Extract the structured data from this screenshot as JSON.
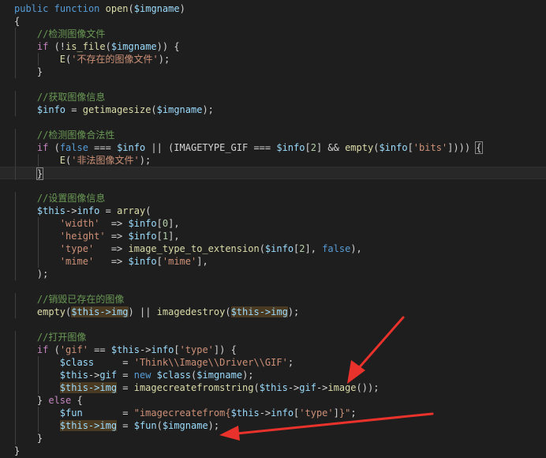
{
  "editor": {
    "lines": [
      [
        [
          "kw",
          "public"
        ],
        [
          "p",
          " "
        ],
        [
          "kw",
          "function"
        ],
        [
          "p",
          " "
        ],
        [
          "fn",
          "open"
        ],
        [
          "p",
          "("
        ],
        [
          "var",
          "$imgname"
        ],
        [
          "p",
          ")"
        ]
      ],
      [
        [
          "p",
          "{"
        ]
      ],
      [
        [
          "p",
          "    "
        ],
        [
          "cm",
          "//检测图像文件"
        ]
      ],
      [
        [
          "p",
          "    "
        ],
        [
          "ctl",
          "if"
        ],
        [
          "p",
          " (!"
        ],
        [
          "fn",
          "is_file"
        ],
        [
          "p",
          "("
        ],
        [
          "var",
          "$imgname"
        ],
        [
          "p",
          ")) {"
        ]
      ],
      [
        [
          "p",
          "        "
        ],
        [
          "fn",
          "E"
        ],
        [
          "p",
          "("
        ],
        [
          "str",
          "'不存在的图像文件'"
        ],
        [
          "p",
          ");"
        ]
      ],
      [
        [
          "p",
          "    }"
        ]
      ],
      [
        [
          "p",
          ""
        ]
      ],
      [
        [
          "p",
          "    "
        ],
        [
          "cm",
          "//获取图像信息"
        ]
      ],
      [
        [
          "p",
          "    "
        ],
        [
          "var",
          "$info"
        ],
        [
          "p",
          " = "
        ],
        [
          "fn",
          "getimagesize"
        ],
        [
          "p",
          "("
        ],
        [
          "var",
          "$imgname"
        ],
        [
          "p",
          ");"
        ]
      ],
      [
        [
          "p",
          ""
        ]
      ],
      [
        [
          "p",
          "    "
        ],
        [
          "cm",
          "//检测图像合法性"
        ]
      ],
      [
        [
          "p",
          "    "
        ],
        [
          "ctl",
          "if"
        ],
        [
          "p",
          " ("
        ],
        [
          "kw",
          "false"
        ],
        [
          "p",
          " === "
        ],
        [
          "var",
          "$info"
        ],
        [
          "p",
          " || (IMAGETYPE_GIF === "
        ],
        [
          "var",
          "$info"
        ],
        [
          "p",
          "["
        ],
        [
          "num",
          "2"
        ],
        [
          "p",
          "] && "
        ],
        [
          "fn",
          "empty"
        ],
        [
          "p",
          "("
        ],
        [
          "var",
          "$info"
        ],
        [
          "p",
          "["
        ],
        [
          "str",
          "'bits'"
        ],
        [
          "p",
          "]))) "
        ],
        [
          "bm",
          "{"
        ]
      ],
      [
        [
          "p",
          "        "
        ],
        [
          "fn",
          "E"
        ],
        [
          "p",
          "("
        ],
        [
          "str",
          "'非法图像文件'"
        ],
        [
          "p",
          ");"
        ]
      ],
      [
        [
          "p",
          "    "
        ],
        [
          "bm",
          "}"
        ]
      ],
      [
        [
          "p",
          ""
        ]
      ],
      [
        [
          "p",
          "    "
        ],
        [
          "cm",
          "//设置图像信息"
        ]
      ],
      [
        [
          "p",
          "    "
        ],
        [
          "var",
          "$this"
        ],
        [
          "p",
          "->"
        ],
        [
          "var",
          "info"
        ],
        [
          "p",
          " = "
        ],
        [
          "fn",
          "array"
        ],
        [
          "p",
          "("
        ]
      ],
      [
        [
          "p",
          "        "
        ],
        [
          "str",
          "'width'"
        ],
        [
          "p",
          "  => "
        ],
        [
          "var",
          "$info"
        ],
        [
          "p",
          "["
        ],
        [
          "num",
          "0"
        ],
        [
          "p",
          "],"
        ]
      ],
      [
        [
          "p",
          "        "
        ],
        [
          "str",
          "'height'"
        ],
        [
          "p",
          " => "
        ],
        [
          "var",
          "$info"
        ],
        [
          "p",
          "["
        ],
        [
          "num",
          "1"
        ],
        [
          "p",
          "],"
        ]
      ],
      [
        [
          "p",
          "        "
        ],
        [
          "str",
          "'type'"
        ],
        [
          "p",
          "   => "
        ],
        [
          "fn",
          "image_type_to_extension"
        ],
        [
          "p",
          "("
        ],
        [
          "var",
          "$info"
        ],
        [
          "p",
          "["
        ],
        [
          "num",
          "2"
        ],
        [
          "p",
          "], "
        ],
        [
          "kw",
          "false"
        ],
        [
          "p",
          "),"
        ]
      ],
      [
        [
          "p",
          "        "
        ],
        [
          "str",
          "'mime'"
        ],
        [
          "p",
          "   => "
        ],
        [
          "var",
          "$info"
        ],
        [
          "p",
          "["
        ],
        [
          "str",
          "'mime'"
        ],
        [
          "p",
          "],"
        ]
      ],
      [
        [
          "p",
          "    );"
        ]
      ],
      [
        [
          "p",
          ""
        ]
      ],
      [
        [
          "p",
          "    "
        ],
        [
          "cm",
          "//销毁已存在的图像"
        ]
      ],
      [
        [
          "p",
          "    "
        ],
        [
          "fn",
          "empty"
        ],
        [
          "p",
          "("
        ],
        [
          "var",
          "$this->img"
        ],
        [
          "p",
          ") || "
        ],
        [
          "fn",
          "imagedestroy"
        ],
        [
          "p",
          "("
        ],
        [
          "var",
          "$this->img"
        ],
        [
          "p",
          ");"
        ]
      ],
      [
        [
          "p",
          ""
        ]
      ],
      [
        [
          "p",
          "    "
        ],
        [
          "cm",
          "//打开图像"
        ]
      ],
      [
        [
          "p",
          "    "
        ],
        [
          "ctl",
          "if"
        ],
        [
          "p",
          " ("
        ],
        [
          "str",
          "'gif'"
        ],
        [
          "p",
          " == "
        ],
        [
          "var",
          "$this"
        ],
        [
          "p",
          "->"
        ],
        [
          "var",
          "info"
        ],
        [
          "p",
          "["
        ],
        [
          "str",
          "'type'"
        ],
        [
          "p",
          "]) {"
        ]
      ],
      [
        [
          "p",
          "        "
        ],
        [
          "var",
          "$class"
        ],
        [
          "p",
          "     = "
        ],
        [
          "str",
          "'Think\\\\Image\\\\Driver\\\\GIF'"
        ],
        [
          "p",
          ";"
        ]
      ],
      [
        [
          "p",
          "        "
        ],
        [
          "var",
          "$this"
        ],
        [
          "p",
          "->"
        ],
        [
          "var",
          "gif"
        ],
        [
          "p",
          " = "
        ],
        [
          "kw",
          "new"
        ],
        [
          "p",
          " "
        ],
        [
          "var",
          "$class"
        ],
        [
          "p",
          "("
        ],
        [
          "var",
          "$imgname"
        ],
        [
          "p",
          ");"
        ]
      ],
      [
        [
          "p",
          "        "
        ],
        [
          "var",
          "$this->img"
        ],
        [
          "p",
          " = "
        ],
        [
          "fn",
          "imagecreatefromstring"
        ],
        [
          "p",
          "("
        ],
        [
          "var",
          "$this"
        ],
        [
          "p",
          "->"
        ],
        [
          "var",
          "gif"
        ],
        [
          "p",
          "->"
        ],
        [
          "fn",
          "image"
        ],
        [
          "p",
          "());"
        ]
      ],
      [
        [
          "p",
          "    } "
        ],
        [
          "ctl",
          "else"
        ],
        [
          "p",
          " {"
        ]
      ],
      [
        [
          "p",
          "        "
        ],
        [
          "var",
          "$fun"
        ],
        [
          "p",
          "       = "
        ],
        [
          "str",
          "\"imagecreatefrom{"
        ],
        [
          "var",
          "$this"
        ],
        [
          "p",
          "->"
        ],
        [
          "var",
          "info"
        ],
        [
          "p",
          "["
        ],
        [
          "str",
          "'type'"
        ],
        [
          "p",
          "]"
        ],
        [
          "str",
          "}\""
        ],
        [
          "p",
          ";"
        ]
      ],
      [
        [
          "p",
          "        "
        ],
        [
          "var",
          "$this->img"
        ],
        [
          "p",
          " = "
        ],
        [
          "var",
          "$fun"
        ],
        [
          "p",
          "("
        ],
        [
          "var",
          "$imgname"
        ],
        [
          "p",
          ");"
        ]
      ],
      [
        [
          "p",
          "    }"
        ]
      ],
      [
        [
          "p",
          "}"
        ]
      ]
    ]
  },
  "highlighted_tokens": [
    "$this->img"
  ],
  "current_line": 13,
  "annotation_color": "#e8322b"
}
